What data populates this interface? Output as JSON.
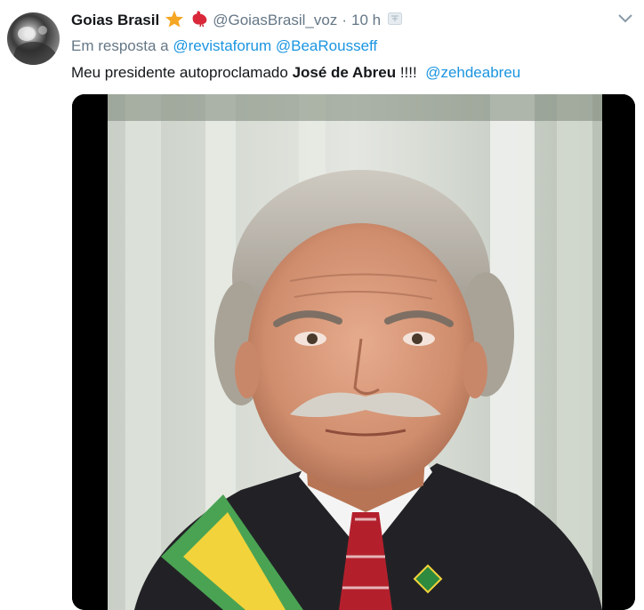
{
  "tweet": {
    "author_name": "Goias Brasil",
    "author_handle": "@GoiasBrasil_voz",
    "separator": "·",
    "time": "10 h",
    "badges": [
      "star-icon",
      "rooster-icon"
    ],
    "reply_prefix": "Em resposta a",
    "reply_to": [
      "@revistaforum",
      "@BeaRousseff"
    ],
    "text_before": "Meu presidente autoproclamado",
    "text_bold": "José de Abreu",
    "text_after": "!!!!",
    "mention": "@zehdeabreu",
    "colors": {
      "link": "#1b95e0",
      "secondary": "#657786",
      "primary": "#14171a"
    }
  }
}
